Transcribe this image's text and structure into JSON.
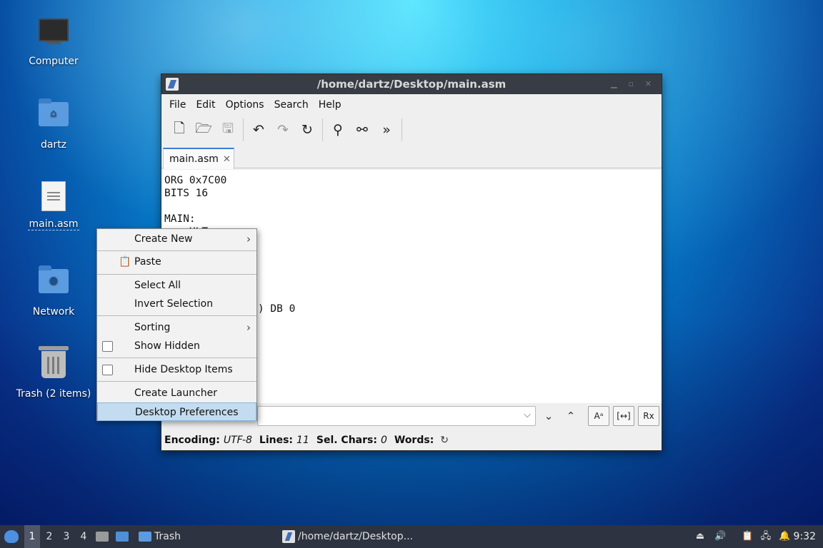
{
  "desktop": {
    "icons": [
      {
        "label": "Computer",
        "icon": "computer-icon"
      },
      {
        "label": "dartz",
        "icon": "home-folder-icon"
      },
      {
        "label": "main.asm",
        "icon": "text-file-icon"
      },
      {
        "label": "Network",
        "icon": "network-folder-icon"
      },
      {
        "label": "Trash (2 items)",
        "icon": "trash-icon"
      }
    ]
  },
  "window": {
    "title": "/home/dartz/Desktop/main.asm",
    "menu": [
      "File",
      "Edit",
      "Options",
      "Search",
      "Help"
    ],
    "toolbar": [
      "new-file-icon",
      "open-folder-icon",
      "save-icon",
      "undo-icon",
      "redo-icon",
      "reload-icon",
      "find-icon",
      "find-replace-icon",
      "more-icon"
    ],
    "tab": {
      "label": "main.asm",
      "close": "✕"
    },
    "code": [
      "ORG 0x7C00",
      "BITS 16",
      "",
      "MAIN:",
      "    HLT",
      "",
      "",
      "",
      "",
      "",
      "TIMES 510-($-$$) DB 0"
    ],
    "status": {
      "encoding_label": "Encoding:",
      "encoding": "UTF-8",
      "lines_label": "Lines:",
      "lines": "11",
      "sel_label": "Sel. Chars:",
      "sel": "0",
      "words_label": "Words:"
    },
    "search": {
      "placeholder": ""
    }
  },
  "context_menu": {
    "items": [
      {
        "label": "Create New",
        "submenu": true
      },
      {
        "label": "Paste"
      },
      {
        "label": "Select All"
      },
      {
        "label": "Invert Selection"
      },
      {
        "label": "Sorting",
        "submenu": true
      },
      {
        "label": "Show Hidden",
        "checkbox": false
      },
      {
        "label": "Hide Desktop Items",
        "checkbox": false
      },
      {
        "label": "Create Launcher"
      },
      {
        "label": "Desktop Preferences",
        "highlighted": true
      }
    ],
    "arrow": "›"
  },
  "taskbar": {
    "workspaces": [
      "1",
      "2",
      "3",
      "4"
    ],
    "tasks": [
      {
        "label": "Trash"
      },
      {
        "label": "/home/dartz/Desktop..."
      }
    ],
    "clock": "9:32"
  }
}
